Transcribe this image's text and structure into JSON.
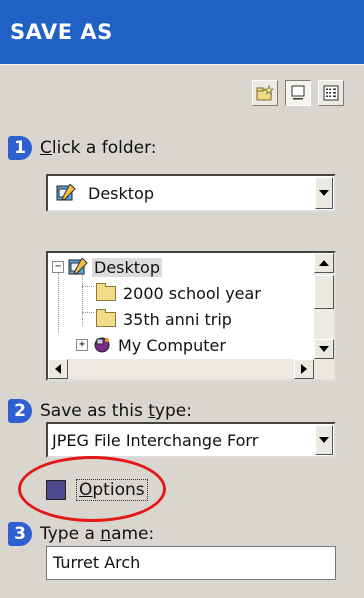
{
  "window": {
    "title": "SAVE AS"
  },
  "toolbar": {
    "buttons": [
      {
        "icon": "new-folder-icon"
      },
      {
        "icon": "large-icons-view-icon",
        "pressed": true
      },
      {
        "icon": "details-view-icon"
      }
    ]
  },
  "step1": {
    "number": "1",
    "label_first": "C",
    "label_rest": "lick a folder:",
    "folder_combo_value": "Desktop"
  },
  "tree": {
    "items": [
      {
        "label": "Desktop",
        "selected": true
      },
      {
        "label": "2000 school year"
      },
      {
        "label": "35th anni trip"
      },
      {
        "label": "My Computer"
      }
    ]
  },
  "step2": {
    "number": "2",
    "label_pre": "Save as this ",
    "label_mnemonic": "t",
    "label_post": "ype:",
    "type_combo_value": "JPEG File Interchange Forr"
  },
  "options": {
    "label_mnemonic": "O",
    "label_rest": "ptions",
    "highlight_color": "#e11919"
  },
  "step3": {
    "number": "3",
    "label_pre": "Type a ",
    "label_mnemonic": "n",
    "label_post": "ame:",
    "name_value": "Turret Arch"
  },
  "colors": {
    "title_bg": "#1f61c4",
    "panel_bg": "#d9d6cf",
    "step_badge": "#2f5fd0"
  }
}
